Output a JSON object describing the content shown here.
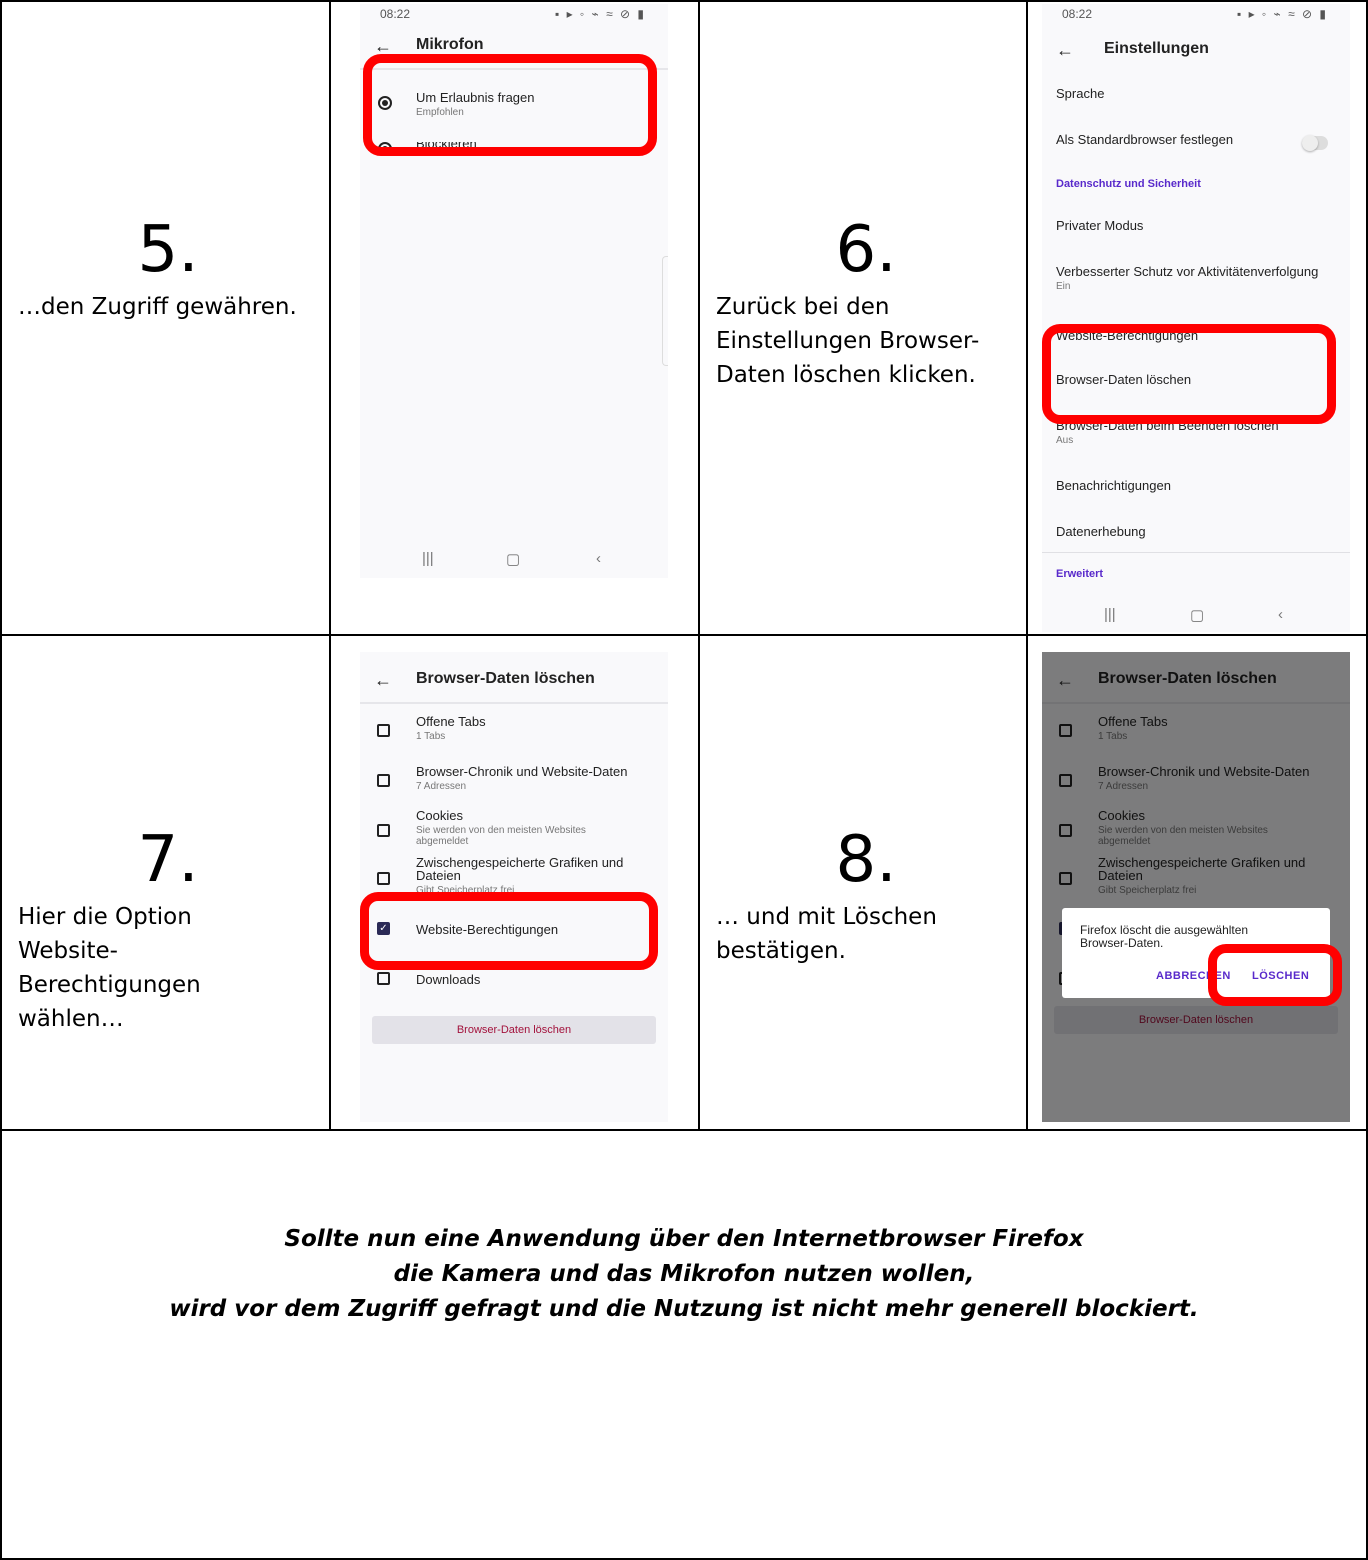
{
  "steps": [
    {
      "number": "5.",
      "description": "…den Zugriff gewähren."
    },
    {
      "number": "6.",
      "description": "Zurück bei den Einstellungen Browser-Daten löschen klicken."
    },
    {
      "number": "7.",
      "description": "Hier die Option Website-Berechtigungen wählen…"
    },
    {
      "number": "8.",
      "description": "… und mit Löschen bestätigen."
    }
  ],
  "screen_mic": {
    "time": "08:22",
    "title": "Mikrofon",
    "option1": "Um Erlaubnis fragen",
    "option1_sub": "Empfohlen",
    "option2_partial": "Blockieren"
  },
  "screen_settings": {
    "time": "08:22",
    "title": "Einstellungen",
    "rows": [
      {
        "label": "Sprache",
        "sub": ""
      },
      {
        "label": "Als Standardbrowser festlegen",
        "sub": ""
      },
      {
        "label": "Privater Modus",
        "sub": ""
      },
      {
        "label": "Verbesserter Schutz vor Aktivitätenverfolgung",
        "sub": "Ein"
      },
      {
        "label": "Website-Berechtigungen",
        "sub": ""
      },
      {
        "label": "Browser-Daten löschen",
        "sub": ""
      },
      {
        "label": "Browser-Daten beim Beenden löschen",
        "sub": "Aus"
      },
      {
        "label": "Benachrichtigungen",
        "sub": ""
      },
      {
        "label": "Datenerhebung",
        "sub": ""
      }
    ],
    "section_privacy": "Datenschutz und Sicherheit",
    "section_advanced": "Erweitert"
  },
  "screen_clear": {
    "title": "Browser-Daten löschen",
    "items": [
      {
        "label": "Offene Tabs",
        "sub": "1 Tabs",
        "checked": false
      },
      {
        "label": "Browser-Chronik und Website-Daten",
        "sub": "7 Adressen",
        "checked": false
      },
      {
        "label": "Cookies",
        "sub": "Sie werden von den meisten Websites abgemeldet",
        "checked": false
      },
      {
        "label": "Zwischengespeicherte Grafiken und Dateien",
        "sub": "Gibt Speicherplatz frei",
        "checked": false
      },
      {
        "label": "Website-Berechtigungen",
        "sub": "",
        "checked": true
      },
      {
        "label": "Downloads",
        "sub": "",
        "checked": false
      }
    ],
    "button": "Browser-Daten löschen"
  },
  "dialog": {
    "message": "Firefox löscht die ausgewählten Browser-Daten.",
    "cancel": "ABBRECHEN",
    "confirm": "LÖSCHEN"
  },
  "footer": {
    "line1": "Sollte nun eine Anwendung über den Internetbrowser Firefox",
    "line2": "die Kamera und das Mikrofon nutzen wollen,",
    "line3": "wird vor dem Zugriff gefragt und die Nutzung ist nicht mehr generell blockiert."
  },
  "colors": {
    "highlight": "#ff0000",
    "firefox_purple": "#592acb",
    "delete_red": "#a3123c"
  }
}
